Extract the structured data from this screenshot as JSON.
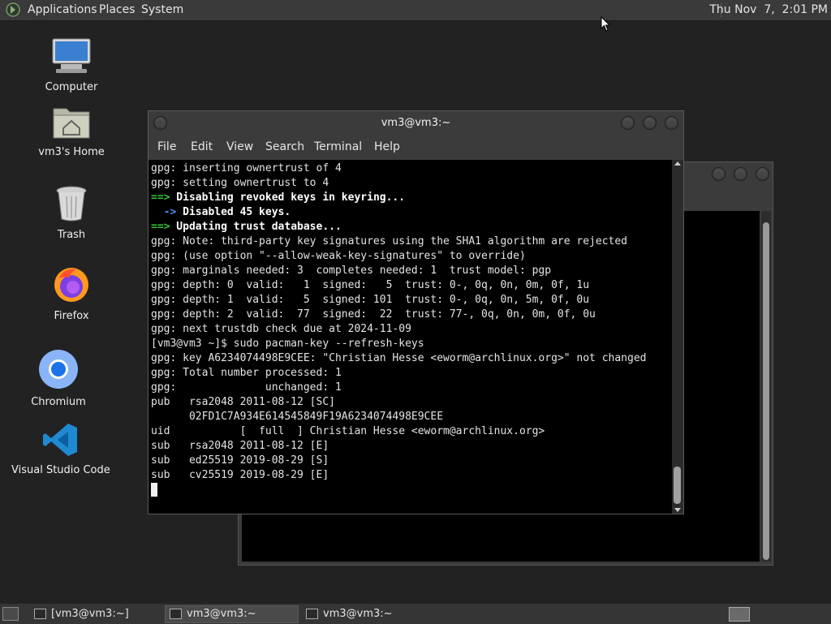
{
  "top_panel": {
    "menus": [
      "Applications",
      "Places",
      "System"
    ],
    "clock": "Thu Nov  7,  2:01 PM"
  },
  "desktop_icons": [
    {
      "label": "Computer",
      "icon": "computer-icon"
    },
    {
      "label": "vm3's Home",
      "icon": "home-folder-icon"
    },
    {
      "label": "Trash",
      "icon": "trash-icon"
    },
    {
      "label": "Firefox",
      "icon": "firefox-icon"
    },
    {
      "label": "Chromium",
      "icon": "chromium-icon"
    },
    {
      "label": "Visual Studio Code",
      "icon": "vscode-icon"
    }
  ],
  "terminal": {
    "title": "vm3@vm3:~",
    "menu": [
      "File",
      "Edit",
      "View",
      "Search",
      "Terminal",
      "Help"
    ],
    "lines": [
      "gpg: inserting ownertrust of 4",
      "gpg: setting ownertrust to 4",
      "==> Disabling revoked keys in keyring...",
      "  -> Disabled 45 keys.",
      "==> Updating trust database...",
      "gpg: Note: third-party key signatures using the SHA1 algorithm are rejected",
      "gpg: (use option \"--allow-weak-key-signatures\" to override)",
      "gpg: marginals needed: 3  completes needed: 1  trust model: pgp",
      "gpg: depth: 0  valid:   1  signed:   5  trust: 0-, 0q, 0n, 0m, 0f, 1u",
      "gpg: depth: 1  valid:   5  signed: 101  trust: 0-, 0q, 0n, 5m, 0f, 0u",
      "gpg: depth: 2  valid:  77  signed:  22  trust: 77-, 0q, 0n, 0m, 0f, 0u",
      "gpg: next trustdb check due at 2024-11-09",
      "[vm3@vm3 ~]$ sudo pacman-key --refresh-keys",
      "gpg: key A6234074498E9CEE: \"Christian Hesse <eworm@archlinux.org>\" not changed",
      "gpg: Total number processed: 1",
      "gpg:              unchanged: 1",
      "pub   rsa2048 2011-08-12 [SC]",
      "      02FD1C7A934E614545849F19A6234074498E9CEE",
      "uid           [  full  ] Christian Hesse <eworm@archlinux.org>",
      "sub   rsa2048 2011-08-12 [E]",
      "sub   ed25519 2019-08-29 [S]",
      "sub   cv25519 2019-08-29 [E]",
      ""
    ]
  },
  "taskbar": {
    "tasks": [
      {
        "label": "[vm3@vm3:~]",
        "active": false
      },
      {
        "label": "vm3@vm3:~",
        "active": true
      },
      {
        "label": "vm3@vm3:~",
        "active": false
      }
    ]
  }
}
